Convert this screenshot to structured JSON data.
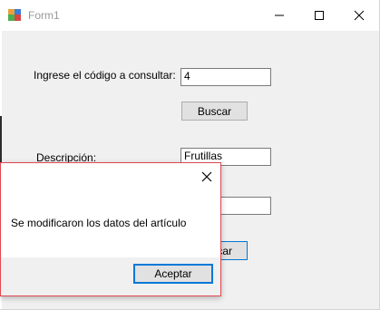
{
  "window": {
    "title": "Form1"
  },
  "form": {
    "codigo_label": "Ingrese el código a consultar:",
    "codigo_value": "4",
    "buscar_label": "Buscar",
    "descripcion_label": "Descripción:",
    "descripcion_value": "Frutillas",
    "second_button_partial": "car"
  },
  "dialog": {
    "message": "Se modificaron los datos del artículo",
    "ok_label": "Aceptar"
  },
  "icons": {
    "app": "windows-form-icon",
    "minimize": "minimize-icon",
    "maximize": "maximize-icon",
    "close": "close-icon",
    "dialog_close": "close-icon"
  }
}
